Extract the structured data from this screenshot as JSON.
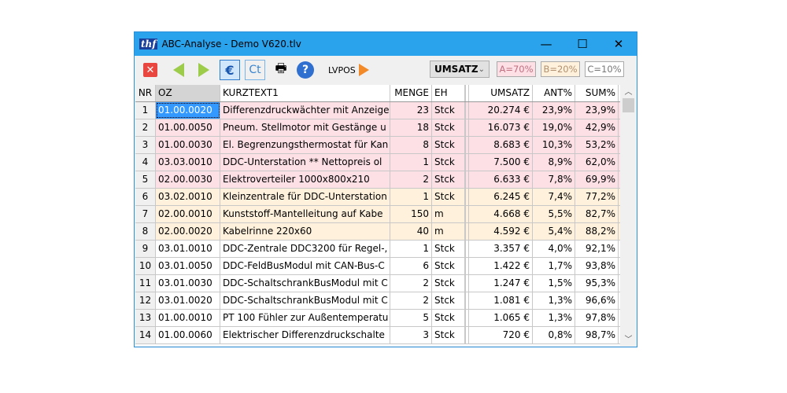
{
  "window": {
    "title": "ABC-Analyse - Demo V620.tlv",
    "logo": "thf",
    "minimize": "—",
    "maximize": "☐",
    "close": "✕"
  },
  "toolbar": {
    "close_icon": "✕",
    "euro": "€",
    "ct": "Ct",
    "help": "?",
    "lvpos": "LVPOS",
    "select_value": "UMSATZ",
    "a": "A=70%",
    "b": "B=20%",
    "c": "C=10%"
  },
  "colors": {
    "A": "#fde0e6",
    "B": "#fff1dc",
    "C": "#ffffff"
  },
  "headers": [
    "NR",
    "OZ",
    "KURZTEXT1",
    "MENGE",
    "EH",
    "UMSATZ",
    "ANT%",
    "SUM%"
  ],
  "rows": [
    [
      "1",
      "01.00.0020",
      "Differenzdruckwächter mit Anzeige",
      "23",
      "Stck",
      "20.274 €",
      "23,9%",
      "23,9%",
      "A"
    ],
    [
      "2",
      "01.00.0050",
      "Pneum. Stellmotor mit Gestänge u",
      "18",
      "Stck",
      "16.073 €",
      "19,0%",
      "42,9%",
      "A"
    ],
    [
      "3",
      "01.00.0030",
      "El. Begrenzungsthermostat für Kan",
      "8",
      "Stck",
      "8.683 €",
      "10,3%",
      "53,2%",
      "A"
    ],
    [
      "4",
      "03.03.0010",
      "DDC-Unterstation  ** Nettopreis ol",
      "1",
      "Stck",
      "7.500 €",
      "8,9%",
      "62,0%",
      "A"
    ],
    [
      "5",
      "02.00.0030",
      "Elektroverteiler 1000x800x210",
      "2",
      "Stck",
      "6.633 €",
      "7,8%",
      "69,9%",
      "A"
    ],
    [
      "6",
      "03.02.0010",
      "Kleinzentrale für DDC-Unterstation",
      "1",
      "Stck",
      "6.245 €",
      "7,4%",
      "77,2%",
      "B"
    ],
    [
      "7",
      "02.00.0010",
      "Kunststoff-Mantelleitung auf Kabe",
      "150",
      "m",
      "4.668 €",
      "5,5%",
      "82,7%",
      "B"
    ],
    [
      "8",
      "02.00.0020",
      "Kabelrinne 220x60",
      "40",
      "m",
      "4.592 €",
      "5,4%",
      "88,2%",
      "B"
    ],
    [
      "9",
      "03.01.0010",
      "DDC-Zentrale DDC3200 für Regel-, ",
      "1",
      "Stck",
      "3.357 €",
      "4,0%",
      "92,1%",
      "C"
    ],
    [
      "10",
      "03.01.0050",
      "DDC-FeldBusModul mit CAN-Bus-C",
      "6",
      "Stck",
      "1.422 €",
      "1,7%",
      "93,8%",
      "C"
    ],
    [
      "11",
      "03.01.0030",
      "DDC-SchaltschrankBusModul mit C",
      "2",
      "Stck",
      "1.247 €",
      "1,5%",
      "95,3%",
      "C"
    ],
    [
      "12",
      "03.01.0020",
      "DDC-SchaltschrankBusModul mit C",
      "2",
      "Stck",
      "1.081 €",
      "1,3%",
      "96,6%",
      "C"
    ],
    [
      "13",
      "01.00.0010",
      "PT 100 Fühler zur Außentemperatu",
      "5",
      "Stck",
      "1.065 €",
      "1,3%",
      "97,8%",
      "C"
    ],
    [
      "14",
      "01.00.0060",
      "Elektrischer Differenzdruckschalte",
      "3",
      "Stck",
      "720 €",
      "0,8%",
      "98,7%",
      "C"
    ]
  ]
}
